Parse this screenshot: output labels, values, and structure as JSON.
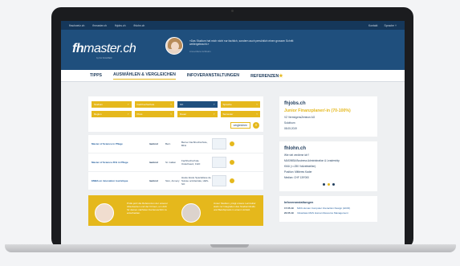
{
  "header": {
    "sites": [
      "fhschweiz.ch",
      "fhmaster.ch",
      "fhjobs.ch",
      "fhlohn.ch"
    ],
    "right_links": [
      "Kontakt",
      "Sprache ˅"
    ],
    "logo_bold": "fh",
    "logo_light": "master.ch",
    "logo_sub": "by FH SCHWEIZ",
    "quote": "«Das Studium hat mich nicht nur fachlich, sondern auch persönlich einen grossen Schritt weitergebracht.»",
    "quote_author": "Anna-Maria Gribbahn"
  },
  "nav": {
    "items": [
      "TIPPS",
      "AUSWÄHLEN & VERGLEICHEN",
      "INFOVERANSTALTUNGEN",
      "REFERENZEN"
    ],
    "active_index": 1,
    "star": "★"
  },
  "filters": [
    "Studium",
    "Fachhochschule",
    "Ort",
    "Sprache",
    "Region",
    "Preis",
    "Dauer",
    "Semester"
  ],
  "compare_label": "vergleichen",
  "compare_icon": "»",
  "programs": [
    {
      "name": "Master of Science in Pflege",
      "mode": "laufend",
      "place": "Bern",
      "school": "Berner Fachhochschule, BFH"
    },
    {
      "name": "Master of Science ZFH in Pflege",
      "mode": "laufend",
      "place": "St. Gallen",
      "school": "Fachhochschule Ostschweiz, FHO"
    },
    {
      "name": "EMBA en innovation touristique",
      "mode": "laufend",
      "place": "Sion, Annecy",
      "school": "Haute Ecole Spécialisée de Suisse occidentale, HES-SO"
    }
  ],
  "promo": {
    "left": "Prüfe jetzt die Referenzen der unserer Absolventen und der Firmen, um dich für deinen nächsten Karriereschritt zu entscheiden.",
    "right": "Unser Studium, prägt unsere Lernkultur stark zur Integration des Studieninhalts und Berufspraxis in einem Umfeld."
  },
  "jobs": {
    "site": "fhjobs.ch",
    "title": "Junior Finanzplaner/-in (70-100%)",
    "company": "VZ VermögensZentrum AG",
    "location": "Solothurn",
    "date": "08.05.2019"
  },
  "salary": {
    "site": "fhlohn.ch",
    "question": "Wie viel verdiene ich?",
    "degree": "MAS/MBA Business Administration & Leadership",
    "size": "KMU (<=250 Vollzeitstellen)",
    "position": "Position: Mittleres Kader",
    "median": "Median: CHF 139'000"
  },
  "events": {
    "heading": "Infoveranstaltungen",
    "items": [
      {
        "date": "17.05.19",
        "title": "MAS Human Computer Interaction Design (HCID)"
      },
      {
        "date": "22.05.19",
        "title": "Infoanlass MAS Human Resource Management"
      }
    ]
  }
}
